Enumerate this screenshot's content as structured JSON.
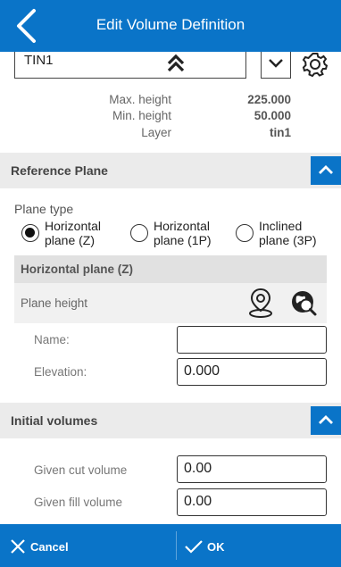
{
  "header": {
    "title": "Edit Volume Definition",
    "back_icon": "chevron-left-icon"
  },
  "surface": {
    "value": "TIN1"
  },
  "info": {
    "max_height_label": "Max. height",
    "max_height_value": "225.000",
    "min_height_label": "Min. height",
    "min_height_value": "50.000",
    "layer_label": "Layer",
    "layer_value": "tin1"
  },
  "reference_plane": {
    "title": "Reference Plane",
    "plane_type_label": "Plane type",
    "options": [
      {
        "line1": "Horizontal",
        "line2": "plane (Z)",
        "selected": true
      },
      {
        "line1": "Horizontal",
        "line2": "plane (1P)",
        "selected": false
      },
      {
        "line1": "Inclined",
        "line2": "plane (3P)",
        "selected": false
      }
    ],
    "subsection_title": "Horizontal plane (Z)",
    "plane_height_label": "Plane height",
    "name_label": "Name:",
    "name_value": "",
    "elevation_label": "Elevation:",
    "elevation_value": "0.000"
  },
  "initial_volumes": {
    "title": "Initial volumes",
    "cut_label": "Given cut volume",
    "cut_value": "0.00",
    "fill_label": "Given fill volume",
    "fill_value": "0.00"
  },
  "footer": {
    "cancel_label": "Cancel",
    "ok_label": "OK"
  },
  "colors": {
    "accent": "#0a74c8",
    "section_bg": "#ebebeb"
  }
}
